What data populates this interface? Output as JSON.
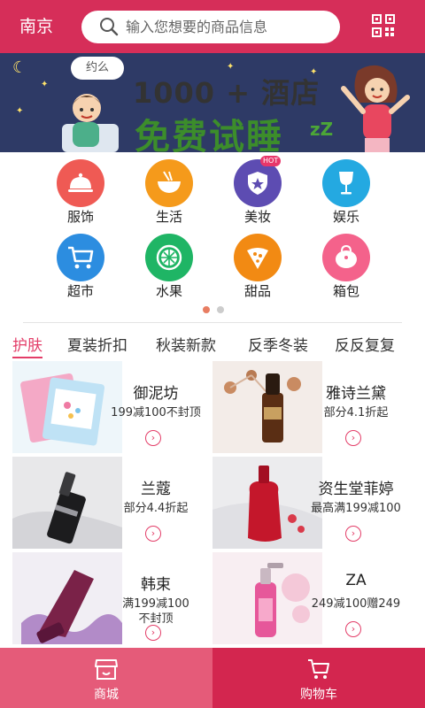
{
  "header": {
    "city": "南京",
    "search_placeholder": "输入您想要的商品信息"
  },
  "banner": {
    "bubble": "约么",
    "headline": "1000 + 酒店",
    "slogan": "免费试睡",
    "zzz": "zZ"
  },
  "categories": [
    {
      "label": "服饰",
      "icon": "cloche-icon",
      "color": "#ef5a54"
    },
    {
      "label": "生活",
      "icon": "bowl-icon",
      "color": "#f59a1b"
    },
    {
      "label": "美妆",
      "icon": "shield-icon",
      "color": "#5d4cb2",
      "badge": "HOT"
    },
    {
      "label": "娱乐",
      "icon": "wine-glass-icon",
      "color": "#24a9e1"
    },
    {
      "label": "超市",
      "icon": "cart-icon",
      "color": "#2c8de0"
    },
    {
      "label": "水果",
      "icon": "lime-icon",
      "color": "#1fb565"
    },
    {
      "label": "甜品",
      "icon": "pizza-icon",
      "color": "#f28a13"
    },
    {
      "label": "箱包",
      "icon": "bag-icon",
      "color": "#f4628b"
    }
  ],
  "pager": {
    "active": 0,
    "count": 2,
    "active_color": "#e87d62",
    "inactive_color": "#cccccc"
  },
  "tabs": [
    "护肤",
    "夏装折扣",
    "秋装新款",
    "反季冬装",
    "反反复复"
  ],
  "products": [
    {
      "brand": "御泥坊",
      "desc": "199减100不封顶"
    },
    {
      "brand": "雅诗兰黛",
      "desc": "部分4.1折起"
    },
    {
      "brand": "兰蔻",
      "desc": "部分4.4折起"
    },
    {
      "brand": "资生堂菲婷",
      "desc": "最高满199减100"
    },
    {
      "brand": "韩束",
      "desc": "满199减100\n不封顶"
    },
    {
      "brand": "ZA",
      "desc": "249减100赠249"
    }
  ],
  "bottom_nav": [
    {
      "label": "商城",
      "icon": "store-icon",
      "active": true
    },
    {
      "label": "购物车",
      "icon": "cart-icon",
      "active": false
    }
  ],
  "colors": {
    "brand": "#d62e59",
    "tab_active": "#e33d68",
    "bottom_active": "#e55b79",
    "bottom_inactive": "#d3264f"
  }
}
